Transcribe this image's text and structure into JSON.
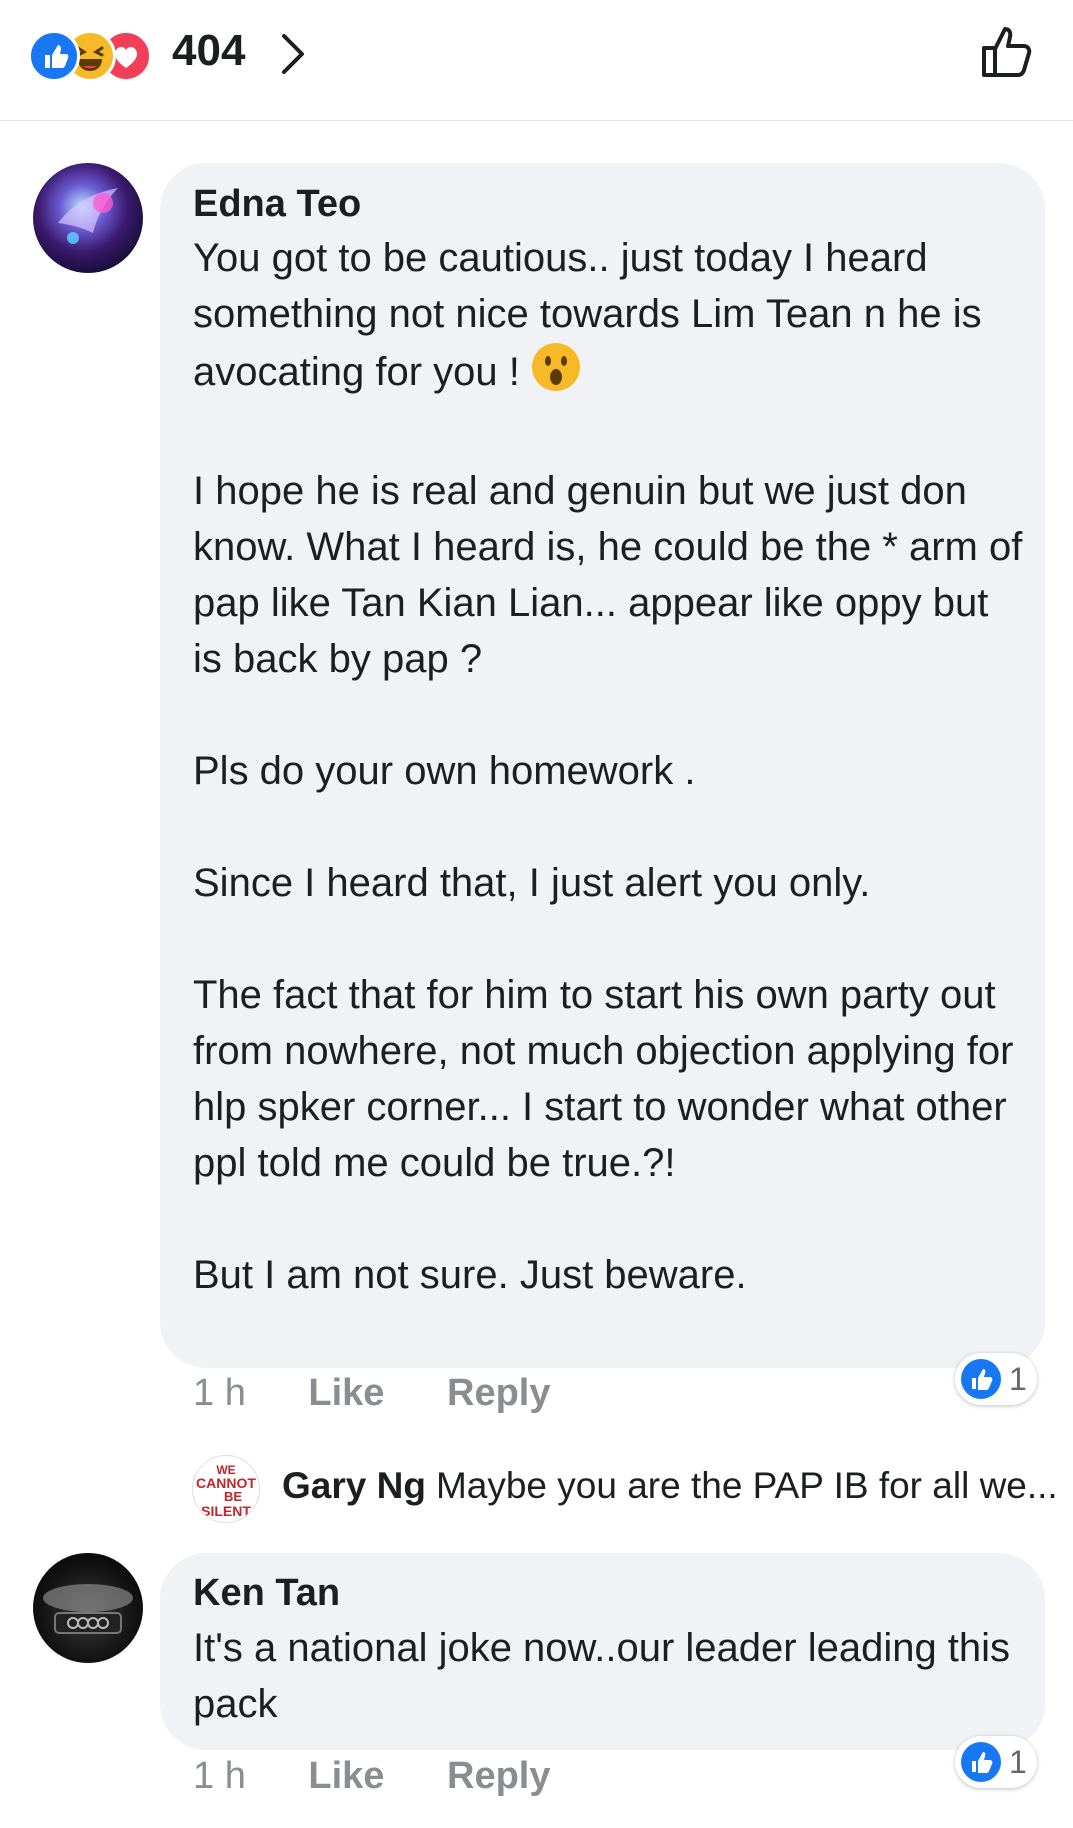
{
  "header": {
    "reaction_count": "404",
    "reaction_icons": [
      "like-icon",
      "haha-icon",
      "love-icon"
    ]
  },
  "comments": [
    {
      "author": "Edna Teo",
      "paragraphs": [
        "You got to be cautious.. just today I heard something not nice towards Lim Tean n he is avocating for you !",
        "I hope he is real and genuin but we just don know. What I heard is, he could be the * arm of pap like Tan Kian Lian... appear like oppy but is back by pap ?",
        "Pls do your own homework .",
        "Since I heard that, I just alert you only.",
        "The fact that for him to start his own party out from nowhere, not much objection applying for hlp spker corner... I start to wonder what other ppl told me could be true.?!",
        "But I am not sure. Just beware."
      ],
      "time": "1 h",
      "like_label": "Like",
      "reply_label": "Reply",
      "like_count": "1",
      "reply_preview": {
        "author": "Gary Ng",
        "text": "Maybe you are the PAP IB for all we..."
      }
    },
    {
      "author": "Ken Tan",
      "paragraphs": [
        "It's a national joke now..our leader leading this pack"
      ],
      "time": "1 h",
      "like_label": "Like",
      "reply_label": "Reply",
      "like_count": "1"
    }
  ],
  "colors": {
    "like_blue": "#1877f2",
    "haha_yellow": "#f7b928",
    "love_red": "#f33e58",
    "bubble_bg": "#f0f2f5",
    "meta_gray": "#8a8d91"
  }
}
